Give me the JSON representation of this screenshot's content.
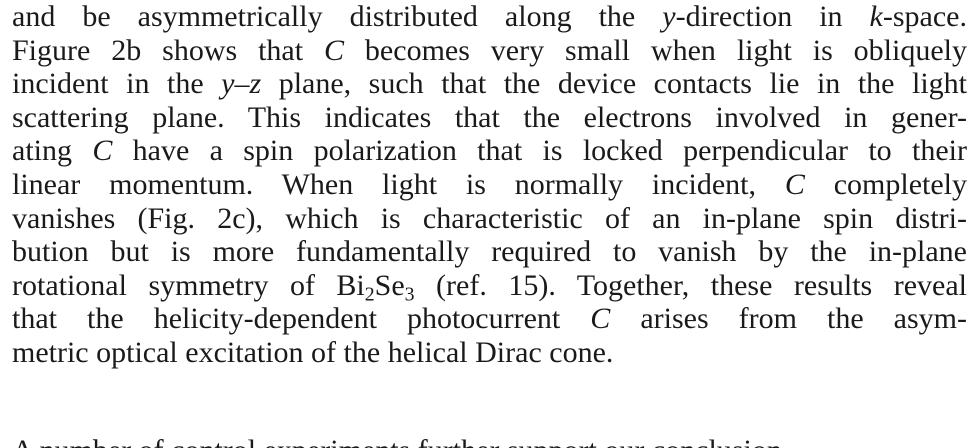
{
  "document": {
    "lines": [
      [
        {
          "t": "and be asymmetrically distributed along the "
        },
        {
          "t": "y",
          "i": true
        },
        {
          "t": "-direction in "
        },
        {
          "t": "k",
          "i": true
        },
        {
          "t": "-space."
        }
      ],
      [
        {
          "t": "Figure 2b shows that "
        },
        {
          "t": "C",
          "i": true
        },
        {
          "t": " becomes very small when light is obliquely"
        }
      ],
      [
        {
          "t": "incident in the "
        },
        {
          "t": "y",
          "i": true
        },
        {
          "t": "–"
        },
        {
          "t": "z",
          "i": true
        },
        {
          "t": " plane, such that the device contacts lie in the light"
        }
      ],
      [
        {
          "t": "scattering plane. This indicates that the electrons involved in gener-"
        }
      ],
      [
        {
          "t": "ating "
        },
        {
          "t": "C",
          "i": true
        },
        {
          "t": " have a spin polarization that is locked perpendicular to their"
        }
      ],
      [
        {
          "t": "linear momentum. When light is normally incident, "
        },
        {
          "t": "C",
          "i": true
        },
        {
          "t": " completely"
        }
      ],
      [
        {
          "t": "vanishes (Fig. 2c), which is characteristic of an in-plane spin distri-"
        }
      ],
      [
        {
          "t": "bution but is more fundamentally required to vanish by the in-plane"
        }
      ],
      [
        {
          "t": "rotational symmetry of Bi"
        },
        {
          "t": "2",
          "sub": true
        },
        {
          "t": "Se"
        },
        {
          "t": "3",
          "sub": true
        },
        {
          "t": " (ref. 15). Together, these results reveal"
        }
      ],
      [
        {
          "t": "that the helicity-dependent photocurrent "
        },
        {
          "t": "C",
          "i": true
        },
        {
          "t": " arises from the asym-"
        }
      ],
      [
        {
          "t": "metric optical excitation of the helical Dirac cone."
        }
      ]
    ],
    "cut_off_line": "A number of control experiments further support our conclusion"
  }
}
